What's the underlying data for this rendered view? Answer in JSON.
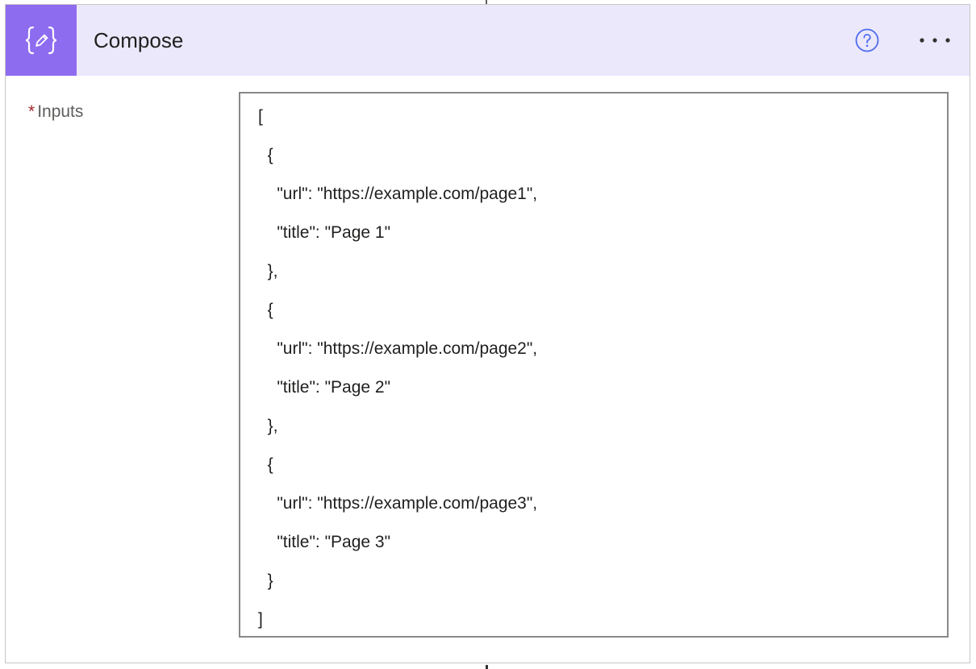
{
  "action": {
    "title": "Compose",
    "icon": "compose-braces-pencil-icon",
    "header_color": "#ebe8fc",
    "icon_bg_color": "#8e6cf0",
    "help_icon": "question-circle-icon",
    "more_icon": "ellipsis-icon"
  },
  "inputs": {
    "required_marker": "*",
    "label": "Inputs",
    "lines": [
      "[",
      "  {",
      "    \"url\": \"https://example.com/page1\",",
      "    \"title\": \"Page 1\"",
      "  },",
      "  {",
      "    \"url\": \"https://example.com/page2\",",
      "    \"title\": \"Page 2\"",
      "  },",
      "  {",
      "    \"url\": \"https://example.com/page3\",",
      "    \"title\": \"Page 3\"",
      "  }",
      "]"
    ]
  }
}
